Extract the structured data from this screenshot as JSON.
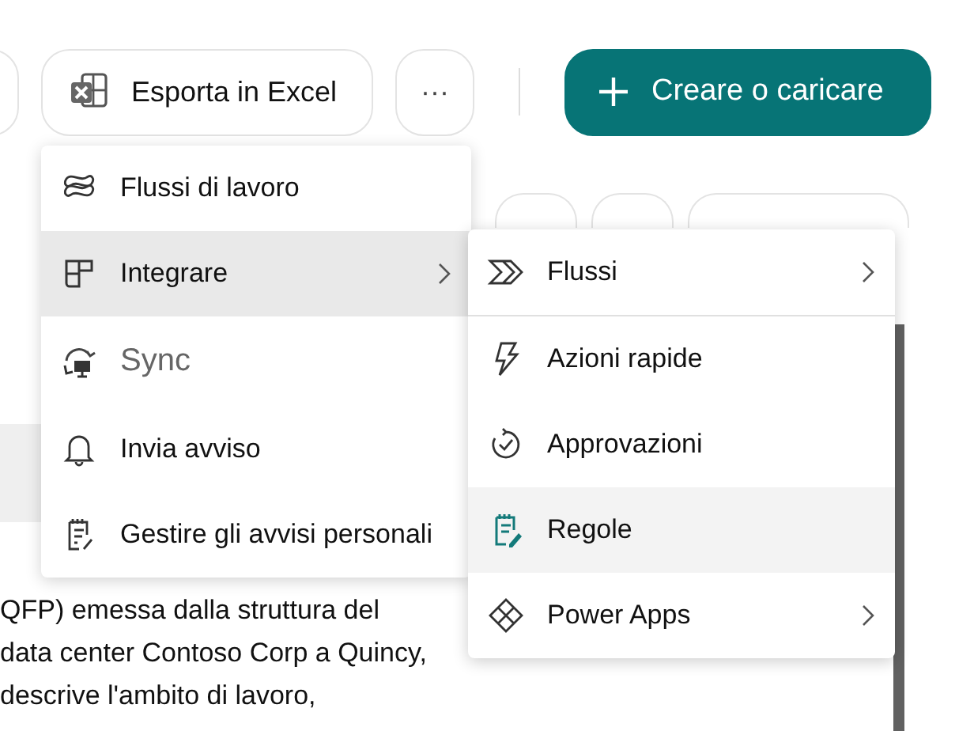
{
  "toolbar": {
    "export_button": "Esporta in Excel",
    "more_button": "···",
    "create_button": "Creare o caricare"
  },
  "body_text": [
    "QFP) emessa dalla struttura del",
    "data center Contoso Corp a Quincy,",
    "descrive l'ambito di lavoro,"
  ],
  "menu": {
    "items": [
      {
        "kind": "flows",
        "label": "Flussi di lavoro",
        "selected": false,
        "disabled": false,
        "submenu": false
      },
      {
        "kind": "integrate",
        "label": "Integrare",
        "selected": true,
        "disabled": false,
        "submenu": true
      },
      {
        "kind": "sync",
        "label": "Sync",
        "selected": false,
        "disabled": true,
        "submenu": false
      },
      {
        "kind": "bell",
        "label": "Invia avviso",
        "selected": false,
        "disabled": false,
        "submenu": false
      },
      {
        "kind": "notes",
        "label": "Gestire gli avvisi personali",
        "selected": false,
        "disabled": false,
        "submenu": false
      }
    ]
  },
  "submenu": {
    "items": [
      {
        "kind": "flow",
        "label": "Flussi",
        "selected": false,
        "submenu": true
      },
      {
        "kind": "bolt",
        "label": "Azioni rapide",
        "selected": false,
        "submenu": false
      },
      {
        "kind": "approve",
        "label": "Approvazioni",
        "selected": false,
        "submenu": false
      },
      {
        "kind": "rules",
        "label": "Regole",
        "selected": true,
        "submenu": false
      },
      {
        "kind": "apps",
        "label": "Power Apps",
        "selected": false,
        "submenu": true
      }
    ]
  }
}
